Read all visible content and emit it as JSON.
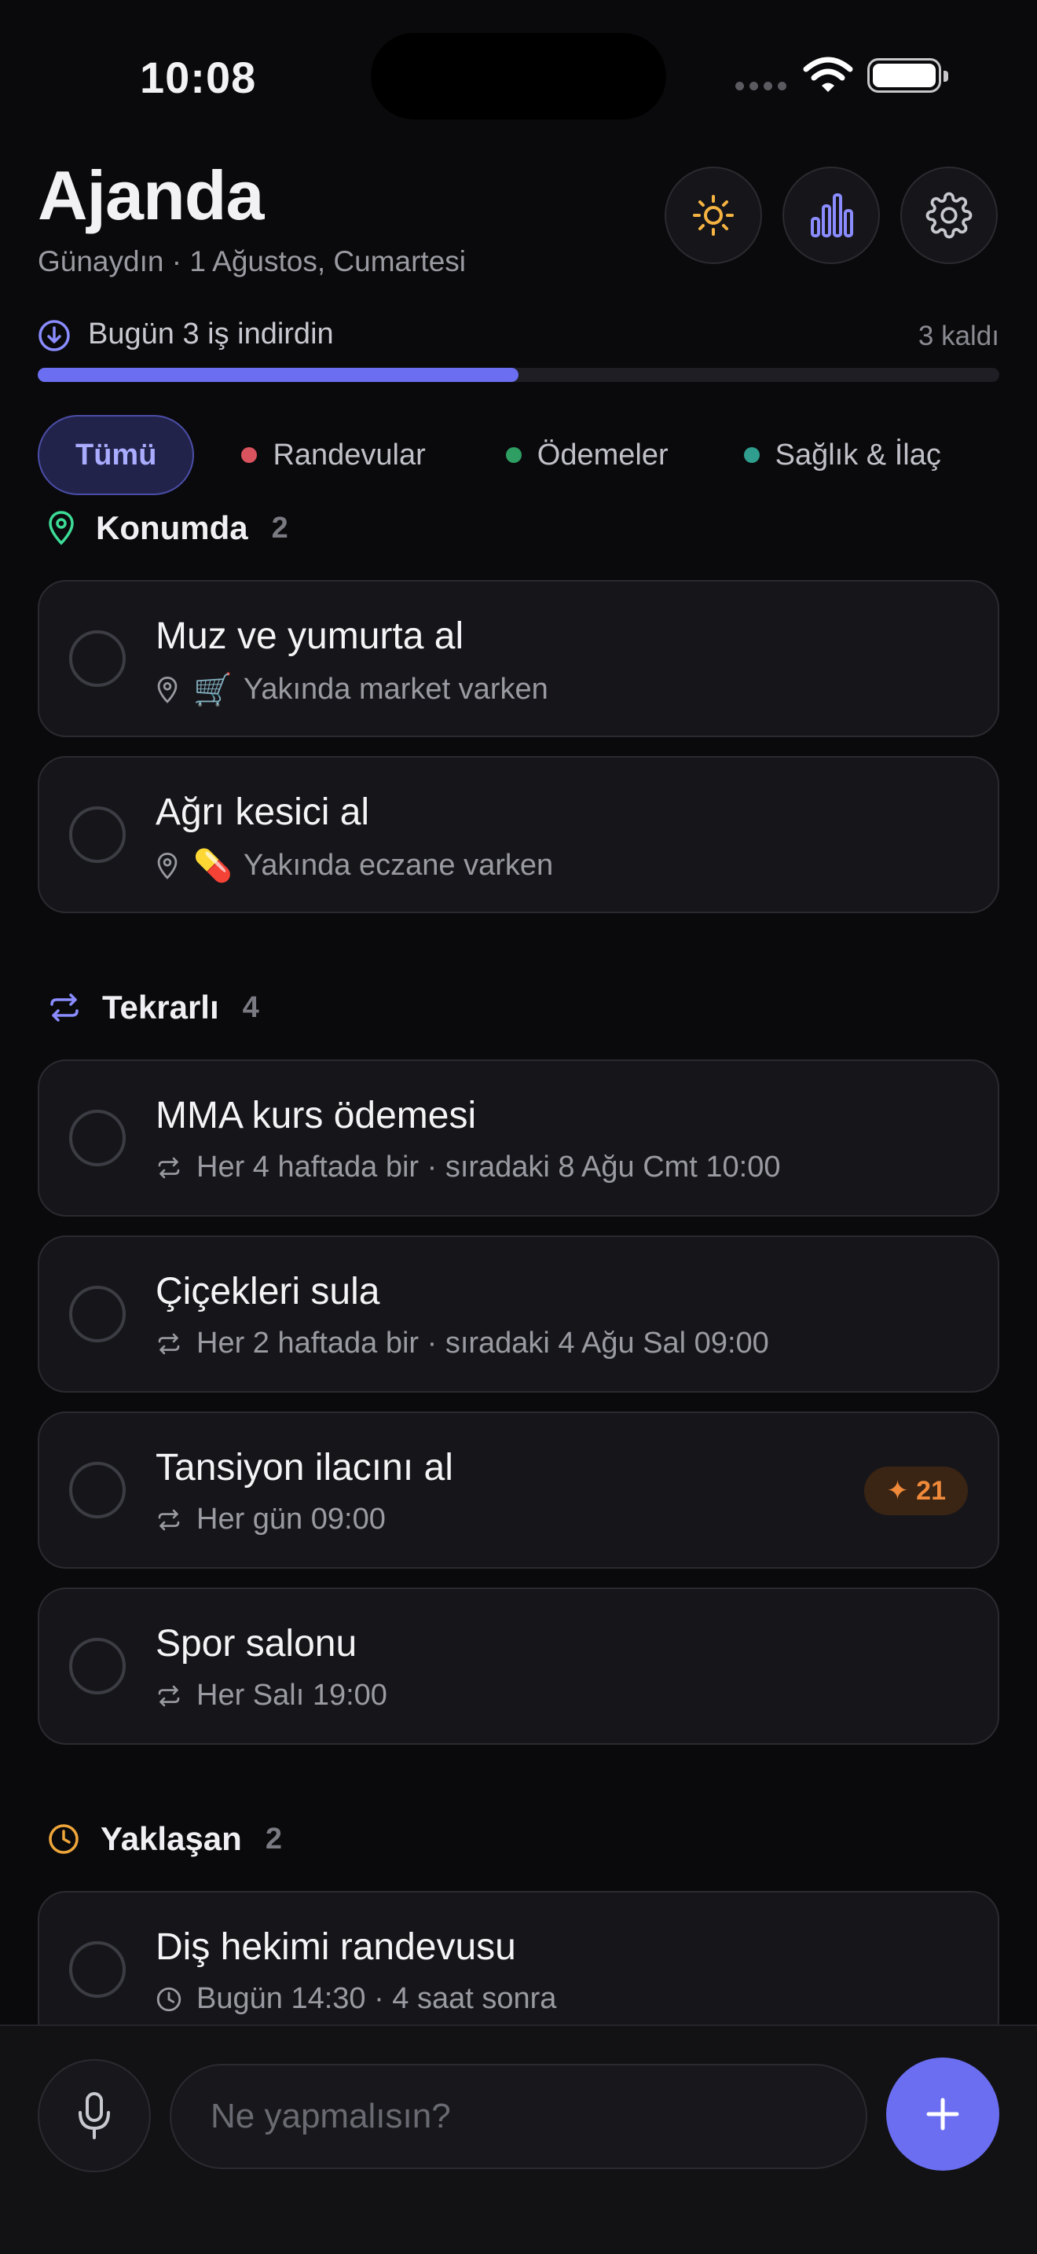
{
  "status_bar": {
    "time": "10:08"
  },
  "header": {
    "title": "Ajanda",
    "subtitle": "Günaydın · 1 Ağustos, Cumartesi",
    "buttons": [
      "sun-icon",
      "bar-chart-icon",
      "gear-icon"
    ]
  },
  "progress": {
    "text": "Bugün 3 iş indirdin",
    "remaining": "3 kaldı",
    "fraction": 0.5
  },
  "filters": {
    "active": "Tümü",
    "items": [
      {
        "label": "Randevular",
        "color": "#d9535f"
      },
      {
        "label": "Ödemeler",
        "color": "#2f9e63"
      },
      {
        "label": "Sağlık & İlaç",
        "color": "#2f9e8e"
      }
    ]
  },
  "sections": {
    "location": {
      "label": "Konumda",
      "count": "2",
      "icon": "location-pin-icon",
      "color": "#3ddc97",
      "items": [
        {
          "title": "Muz ve yumurta al",
          "emoji": "🛒",
          "meta": "Yakında market varken"
        },
        {
          "title": "Ağrı kesici al",
          "emoji": "💊",
          "meta": "Yakında eczane varken"
        }
      ]
    },
    "recurring": {
      "label": "Tekrarlı",
      "count": "4",
      "icon": "repeat-icon",
      "color": "#8a8cff",
      "items": [
        {
          "title": "MMA kurs ödemesi",
          "meta": "Her 4 haftada bir · sıradaki 8 Ağu Cmt 10:00"
        },
        {
          "title": "Çiçekleri sula",
          "meta": "Her 2 haftada bir · sıradaki 4 Ağu Sal 09:00"
        },
        {
          "title": "Tansiyon ilacını al",
          "meta": "Her gün 09:00",
          "streak": "✦ 21"
        },
        {
          "title": "Spor salonu",
          "meta": "Her Salı 19:00"
        }
      ]
    },
    "upcoming": {
      "label": "Yaklaşan",
      "count": "2",
      "icon": "clock-icon",
      "color": "#f0a63a",
      "items": [
        {
          "title": "Diş hekimi randevusu",
          "meta": "Bugün 14:30 · 4 saat sonra"
        }
      ]
    }
  },
  "composer": {
    "placeholder": "Ne yapmalısın?"
  }
}
